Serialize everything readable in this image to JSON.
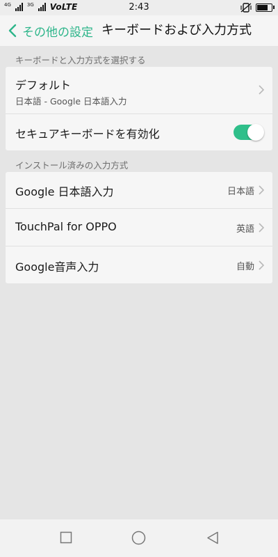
{
  "status_bar": {
    "net_left": "4G",
    "net_right": "3G",
    "network": "VoLTE",
    "time": "2:43",
    "battery_level": 0.85,
    "icons": [
      "signal-icon",
      "signal-icon",
      "mute-vibrate-icon",
      "battery-icon"
    ]
  },
  "header": {
    "back_label": "その他の設定",
    "title": "キーボードおよび入力方式",
    "accent_color": "#2db58a"
  },
  "section1": {
    "label": "キーボードと入力方式を選択する",
    "default": {
      "title": "デフォルト",
      "subtitle": "日本語 - Google 日本語入力"
    },
    "secure_keyboard": {
      "title": "セキュアキーボードを有効化",
      "enabled": true,
      "toggle_color": "#2fbf8a"
    }
  },
  "section2": {
    "label": "インストール済みの入力方式",
    "items": [
      {
        "title": "Google 日本語入力",
        "value": "日本語"
      },
      {
        "title": "TouchPal for OPPO",
        "value": "英語"
      },
      {
        "title": "Google音声入力",
        "value": "自動"
      }
    ]
  },
  "nav_bar": {
    "icons": [
      "recents-square-icon",
      "home-circle-icon",
      "back-triangle-icon"
    ]
  }
}
